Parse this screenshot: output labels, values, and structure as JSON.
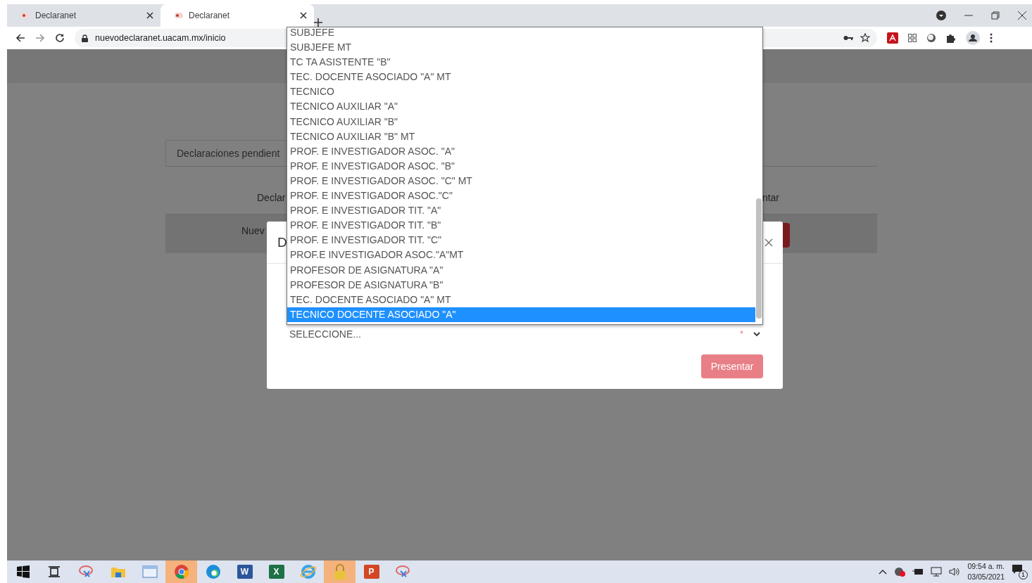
{
  "browser": {
    "tabs": [
      {
        "title": "Declaranet",
        "selected": false
      },
      {
        "title": "Declaranet",
        "selected": true
      }
    ],
    "address": "nuevodeclaranet.uacam.mx/inicio"
  },
  "page": {
    "card_tab": "Declaraciones pendient",
    "column_1": "Declar",
    "column_2": "ntar",
    "row_text": "Nuev"
  },
  "modal": {
    "title": "D",
    "select": {
      "value": "SELECCIONE...",
      "required_mark": "*"
    },
    "button": "Presentar"
  },
  "dropdown": {
    "options": [
      {
        "label": "SUBJEFE",
        "selected": false
      },
      {
        "label": "SUBJEFE MT",
        "selected": false
      },
      {
        "label": "TC TA ASISTENTE \"B\"",
        "selected": false
      },
      {
        "label": "TEC. DOCENTE ASOCIADO \"A\" MT",
        "selected": false
      },
      {
        "label": "TECNICO",
        "selected": false
      },
      {
        "label": "TECNICO AUXILIAR \"A\"",
        "selected": false
      },
      {
        "label": "TECNICO AUXILIAR \"B\"",
        "selected": false
      },
      {
        "label": "TECNICO AUXILIAR \"B\" MT",
        "selected": false
      },
      {
        "label": "PROF. E INVESTIGADOR ASOC. \"A\"",
        "selected": false
      },
      {
        "label": "PROF. E INVESTIGADOR ASOC. \"B\"",
        "selected": false
      },
      {
        "label": "PROF. E INVESTIGADOR ASOC. \"C\" MT",
        "selected": false
      },
      {
        "label": "PROF. E INVESTIGADOR ASOC.\"C\"",
        "selected": false
      },
      {
        "label": "PROF. E INVESTIGADOR TIT. \"A\"",
        "selected": false
      },
      {
        "label": "PROF. E INVESTIGADOR TIT. \"B\"",
        "selected": false
      },
      {
        "label": "PROF. E INVESTIGADOR TIT. \"C\"",
        "selected": false
      },
      {
        "label": "PROF.E INVESTIGADOR ASOC.\"A\"MT",
        "selected": false
      },
      {
        "label": "PROFESOR DE ASIGNATURA \"A\"",
        "selected": false
      },
      {
        "label": "PROFESOR DE ASIGNATURA \"B\"",
        "selected": false
      },
      {
        "label": "TEC. DOCENTE ASOCIADO \"A\" MT",
        "selected": false
      },
      {
        "label": "TECNICO DOCENTE ASOCIADO \"A\"",
        "selected": true
      }
    ]
  },
  "taskbar": {
    "apps": [
      {
        "kind": "start",
        "active": false
      },
      {
        "kind": "taskview",
        "active": false
      },
      {
        "kind": "snip",
        "active": false
      },
      {
        "kind": "folder",
        "active": false
      },
      {
        "kind": "window",
        "active": false
      },
      {
        "kind": "chrome",
        "active": true
      },
      {
        "kind": "edge",
        "active": false
      },
      {
        "kind": "word",
        "glyph": "W",
        "active": false
      },
      {
        "kind": "excel",
        "glyph": "X",
        "active": false
      },
      {
        "kind": "ie",
        "active": false
      },
      {
        "kind": "lock",
        "active": true
      },
      {
        "kind": "ppt",
        "glyph": "P",
        "active": false
      },
      {
        "kind": "snip",
        "active": false
      }
    ],
    "time": "09:54 a. m.",
    "date": "03/05/2021",
    "notifications": "1"
  }
}
